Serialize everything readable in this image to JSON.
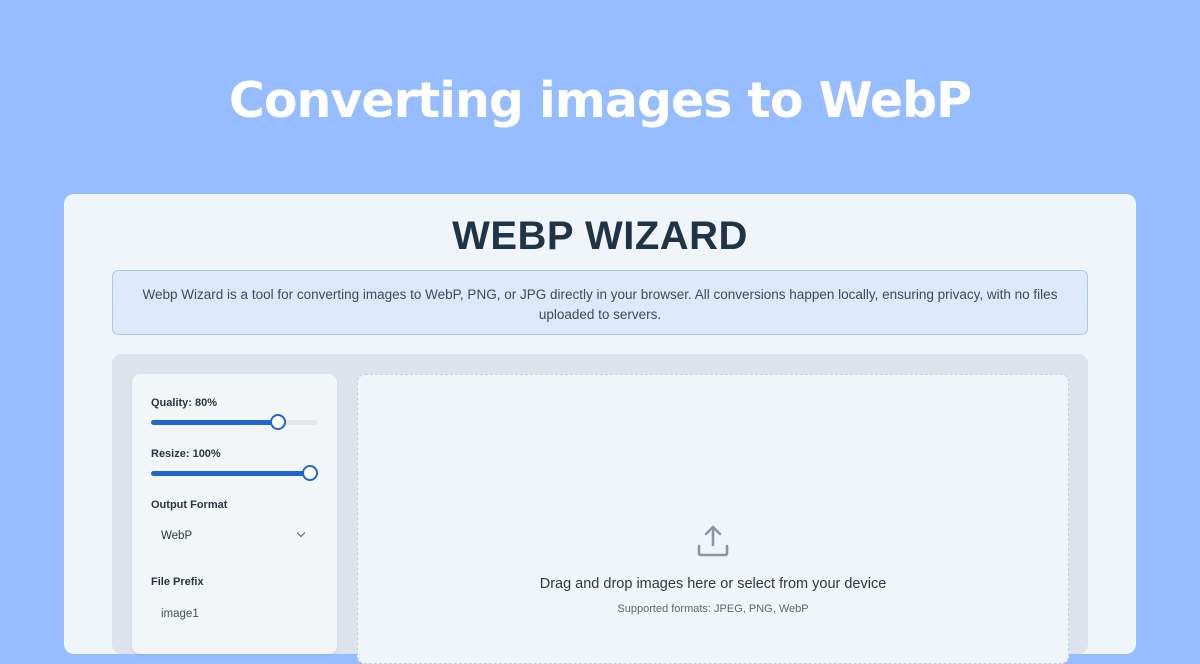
{
  "hero": {
    "title": "Converting images to WebP"
  },
  "app": {
    "title": "WEBP WIZARD",
    "description": "Webp Wizard is a tool for converting images to WebP, PNG, or JPG directly in your browser. All conversions happen locally, ensuring privacy, with no files uploaded to servers."
  },
  "settings": {
    "quality": {
      "label": "Quality: 80%",
      "value_percent": 80
    },
    "resize": {
      "label": "Resize: 100%",
      "value_percent": 100
    },
    "output_format": {
      "label": "Output Format",
      "selected": "WebP"
    },
    "file_prefix": {
      "label": "File Prefix",
      "value": "image1"
    }
  },
  "dropzone": {
    "icon": "upload-icon",
    "primary_text": "Drag and drop images here or select from your device",
    "secondary_text": "Supported formats: JPEG, PNG, WebP"
  },
  "colors": {
    "background": "#96bdff",
    "accent": "#2563d0",
    "title": "#1f3447",
    "info_bg": "#dce9fb"
  }
}
